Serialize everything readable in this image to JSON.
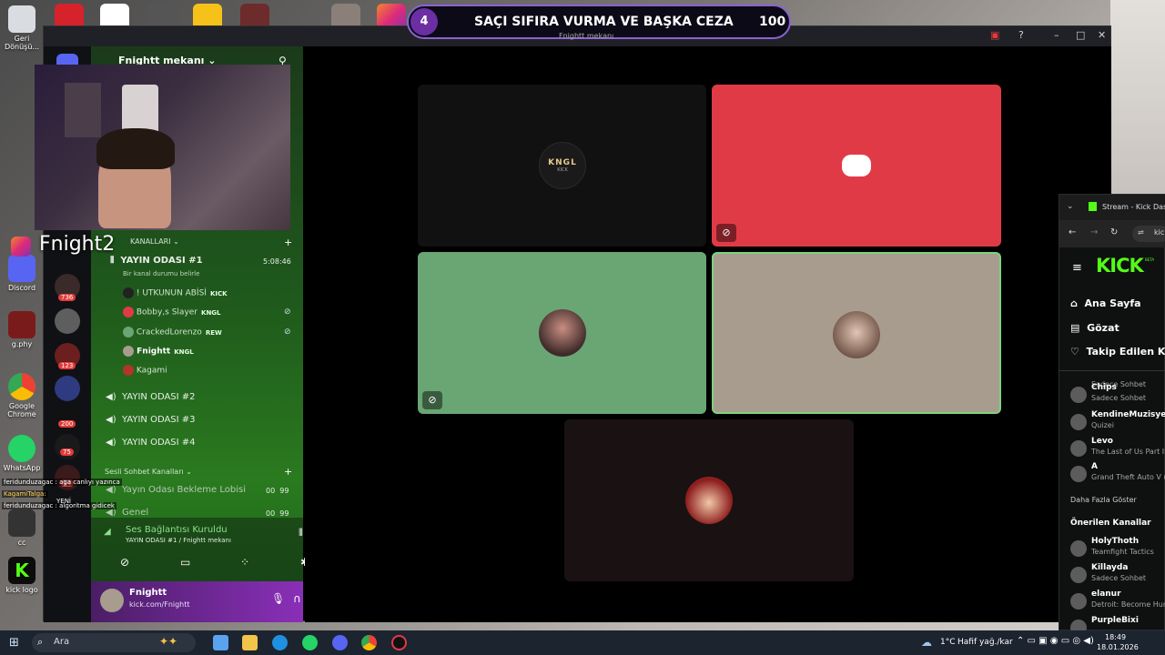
{
  "desktop": {
    "icons": [
      {
        "label": "Geri Dönüşü..."
      },
      {
        "label": "Discord"
      },
      {
        "label": "g.phy"
      },
      {
        "label": "Google Chrome"
      },
      {
        "label": "WhatsApp"
      },
      {
        "label": "cc"
      },
      {
        "label": "kick logo"
      }
    ]
  },
  "overlay": {
    "round": "4",
    "title": "SAÇI SIFIRA VURMA VE BAŞKA CEZA",
    "score": "100",
    "sub": "Fnightt mekanı"
  },
  "webcam": {
    "instagram_handle": "Fnight2"
  },
  "discord": {
    "server_name": "Fnightt mekanı",
    "server_badges": [
      "736",
      "123",
      "200",
      "75",
      "14"
    ],
    "category_voice": "KANALLARI",
    "active_channel": {
      "name": "YAYIN ODASI #1",
      "timer": "5:08:46",
      "status": "Bir kanal durumu belirle"
    },
    "members": [
      {
        "name": "! UTKUNUN ABİSİ",
        "tag": "KICK"
      },
      {
        "name": "Bobby,s Slayer",
        "tag": "KNGL"
      },
      {
        "name": "CrackedLorenzo",
        "tag": "REW"
      },
      {
        "name": "Fnightt",
        "tag": "KNGL"
      },
      {
        "name": "Kagami",
        "tag": ""
      }
    ],
    "channels": [
      "YAYIN ODASI #2",
      "YAYIN ODASI #3",
      "YAYIN ODASI #4"
    ],
    "category_chat": "Sesli Sohbet Kanalları",
    "chat_channels": [
      {
        "name": "Yayın Odası Bekleme Lobisi",
        "c1": "00",
        "c2": "99"
      },
      {
        "name": "Genel",
        "c1": "00",
        "c2": "99"
      }
    ],
    "voice_status": "Ses Bağlantısı Kuruldu",
    "voice_location": "YAYIN ODASI #1 / Fnightt mekanı",
    "user": {
      "name": "Fnightt",
      "status": "kick.com/Fnightt"
    },
    "tiles": [
      {
        "label": "KNGL",
        "sub": "KICK"
      }
    ]
  },
  "stream_chat": [
    {
      "text": "feridunduzagac : aga canlıyı yazınca"
    },
    {
      "text": "KagamiTalga:"
    },
    {
      "text": "feridunduzagac : algoritma gidicek"
    }
  ],
  "stream_tag": "YENİ",
  "browser": {
    "tab_title": "Stream - Kick Dashb",
    "url": "kic",
    "logo": "KICK",
    "beta": "BETA",
    "nav": [
      "Ana Sayfa",
      "Gözat",
      "Takip Edilen Kan"
    ],
    "followed": [
      {
        "name": "",
        "sub": "Sadece Sohbet"
      },
      {
        "name": "Chips",
        "sub": "Sadece Sohbet"
      },
      {
        "name": "KendineMuzisyen",
        "sub": "Quizei"
      },
      {
        "name": "Levo",
        "sub": "The Last of Us Part II"
      },
      {
        "name": "A",
        "sub": "Grand Theft Auto V ("
      }
    ],
    "show_more": "Daha Fazla Göster",
    "recommended_title": "Önerilen Kanallar",
    "recommended": [
      {
        "name": "HolyThoth",
        "sub": "Teamfight Tactics"
      },
      {
        "name": "Killayda",
        "sub": "Sadece Sohbet"
      },
      {
        "name": "elanur",
        "sub": "Detroit: Become Hum"
      },
      {
        "name": "PurpleBixi",
        "sub": ""
      }
    ]
  },
  "taskbar": {
    "search": "Ara",
    "weather": "1°C",
    "weather_desc": "Hafif yağ./kar",
    "time": "18:49",
    "date": "18.01.2026"
  },
  "colors": {
    "discord_red": "#e13a47",
    "tile_green": "#6aa574",
    "tile_tan": "#a89c8f",
    "kick_green": "#53fc18"
  }
}
